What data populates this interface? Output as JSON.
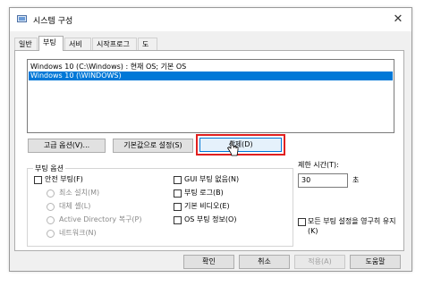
{
  "window": {
    "title": "시스템 구성",
    "close_glyph": "✕"
  },
  "tabs": [
    {
      "label": "일반",
      "active": false
    },
    {
      "label": "부팅",
      "active": true
    },
    {
      "label": "서비스",
      "active": false
    },
    {
      "label": "시작프로그램",
      "active": false
    },
    {
      "label": "도구",
      "active": false
    }
  ],
  "os_list": [
    {
      "label": "Windows 10 (C:\\Windows) : 현재 OS; 기본 OS",
      "selected": false
    },
    {
      "label": "Windows 10 (\\WINDOWS)",
      "selected": true
    }
  ],
  "buttons": {
    "advanced": "고급 옵션(V)...",
    "set_default": "기본값으로 설정(S)",
    "delete": "삭제(D)"
  },
  "boot_options": {
    "label": "부팅 옵션",
    "safe_boot": "안전 부팅(F)",
    "radios": [
      "최소 설치(M)",
      "대체 셸(L)",
      "Active Directory 복구(P)",
      "네트워크(N)"
    ],
    "checks": [
      "GUI 부팅 없음(N)",
      "부팅 로그(B)",
      "기본 비디오(E)",
      "OS 부팅 정보(O)"
    ]
  },
  "timeout": {
    "label": "제한 시간(T):",
    "value": "30",
    "unit": "초"
  },
  "persist": {
    "label": "모든 부팅 설정을 영구히 유지",
    "key": "(K)"
  },
  "footer": {
    "ok": "확인",
    "cancel": "취소",
    "apply": "적용(A)",
    "help": "도움말"
  },
  "icons": {
    "app": "system-config-icon",
    "pointer": "hand-pointer-icon"
  },
  "colors": {
    "selection": "#0078d7",
    "highlight_box": "#e02020"
  }
}
